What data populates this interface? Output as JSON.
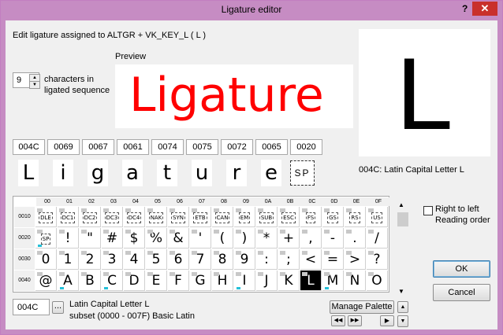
{
  "window": {
    "title": "Ligature editor",
    "help": "?",
    "close": "✕"
  },
  "header": {
    "text": "Edit ligature assigned to ALTGR + VK_KEY_L ( L )"
  },
  "count": {
    "value": "9",
    "label_line1": "characters in",
    "label_line2": "ligated sequence"
  },
  "preview": {
    "label": "Preview",
    "text": "Ligature",
    "color": "#ff0000"
  },
  "big_char": {
    "glyph": "L",
    "caption": "004C: Latin Capital Letter L"
  },
  "sequence": [
    {
      "code": "004C",
      "glyph": "L"
    },
    {
      "code": "0069",
      "glyph": "i"
    },
    {
      "code": "0067",
      "glyph": "g"
    },
    {
      "code": "0061",
      "glyph": "a"
    },
    {
      "code": "0074",
      "glyph": "t"
    },
    {
      "code": "0075",
      "glyph": "u"
    },
    {
      "code": "0072",
      "glyph": "r"
    },
    {
      "code": "0065",
      "glyph": "e"
    },
    {
      "code": "0020",
      "glyph": "SP"
    }
  ],
  "grid": {
    "col_headers": [
      "00",
      "01",
      "02",
      "03",
      "04",
      "05",
      "06",
      "07",
      "08",
      "09",
      "0A",
      "0B",
      "0C",
      "0D",
      "0E",
      "0F"
    ],
    "rows": [
      {
        "label": "0010",
        "cells": [
          "DLE",
          "DC1",
          "DC2",
          "DC3",
          "DC4",
          "NAK",
          "SYN",
          "ETB",
          "CAN",
          "EM",
          "SUB",
          "ESC",
          "FS",
          "GS",
          "RS",
          "US"
        ]
      },
      {
        "label": "0020",
        "cells": [
          "SP",
          "!",
          "\"",
          "#",
          "$",
          "%",
          "&",
          "'",
          "(",
          ")",
          "*",
          "+",
          ",",
          "-",
          ".",
          "/"
        ]
      },
      {
        "label": "0030",
        "cells": [
          "0",
          "1",
          "2",
          "3",
          "4",
          "5",
          "6",
          "7",
          "8",
          "9",
          ":",
          ";",
          "<",
          "=",
          ">",
          "?"
        ]
      },
      {
        "label": "0040",
        "cells": [
          "@",
          "A",
          "B",
          "C",
          "D",
          "E",
          "F",
          "G",
          "H",
          "I",
          "J",
          "K",
          "L",
          "M",
          "N",
          "O"
        ]
      }
    ],
    "selected": "L"
  },
  "rtl": {
    "line1": "Right to left",
    "line2": "Reading order"
  },
  "buttons": {
    "ok": "OK",
    "cancel": "Cancel",
    "manage_palette": "Manage Palette"
  },
  "footer": {
    "code": "004C",
    "more": "...",
    "name": "Latin Capital Letter L",
    "subset": "subset (0000 - 007F) Basic Latin"
  },
  "icons": {
    "nav_first": "◀◀",
    "nav_prev_fast": "◀◀",
    "nav_next_fast": "▶▶",
    "scroll_up": "▲",
    "scroll_down": "▼"
  }
}
